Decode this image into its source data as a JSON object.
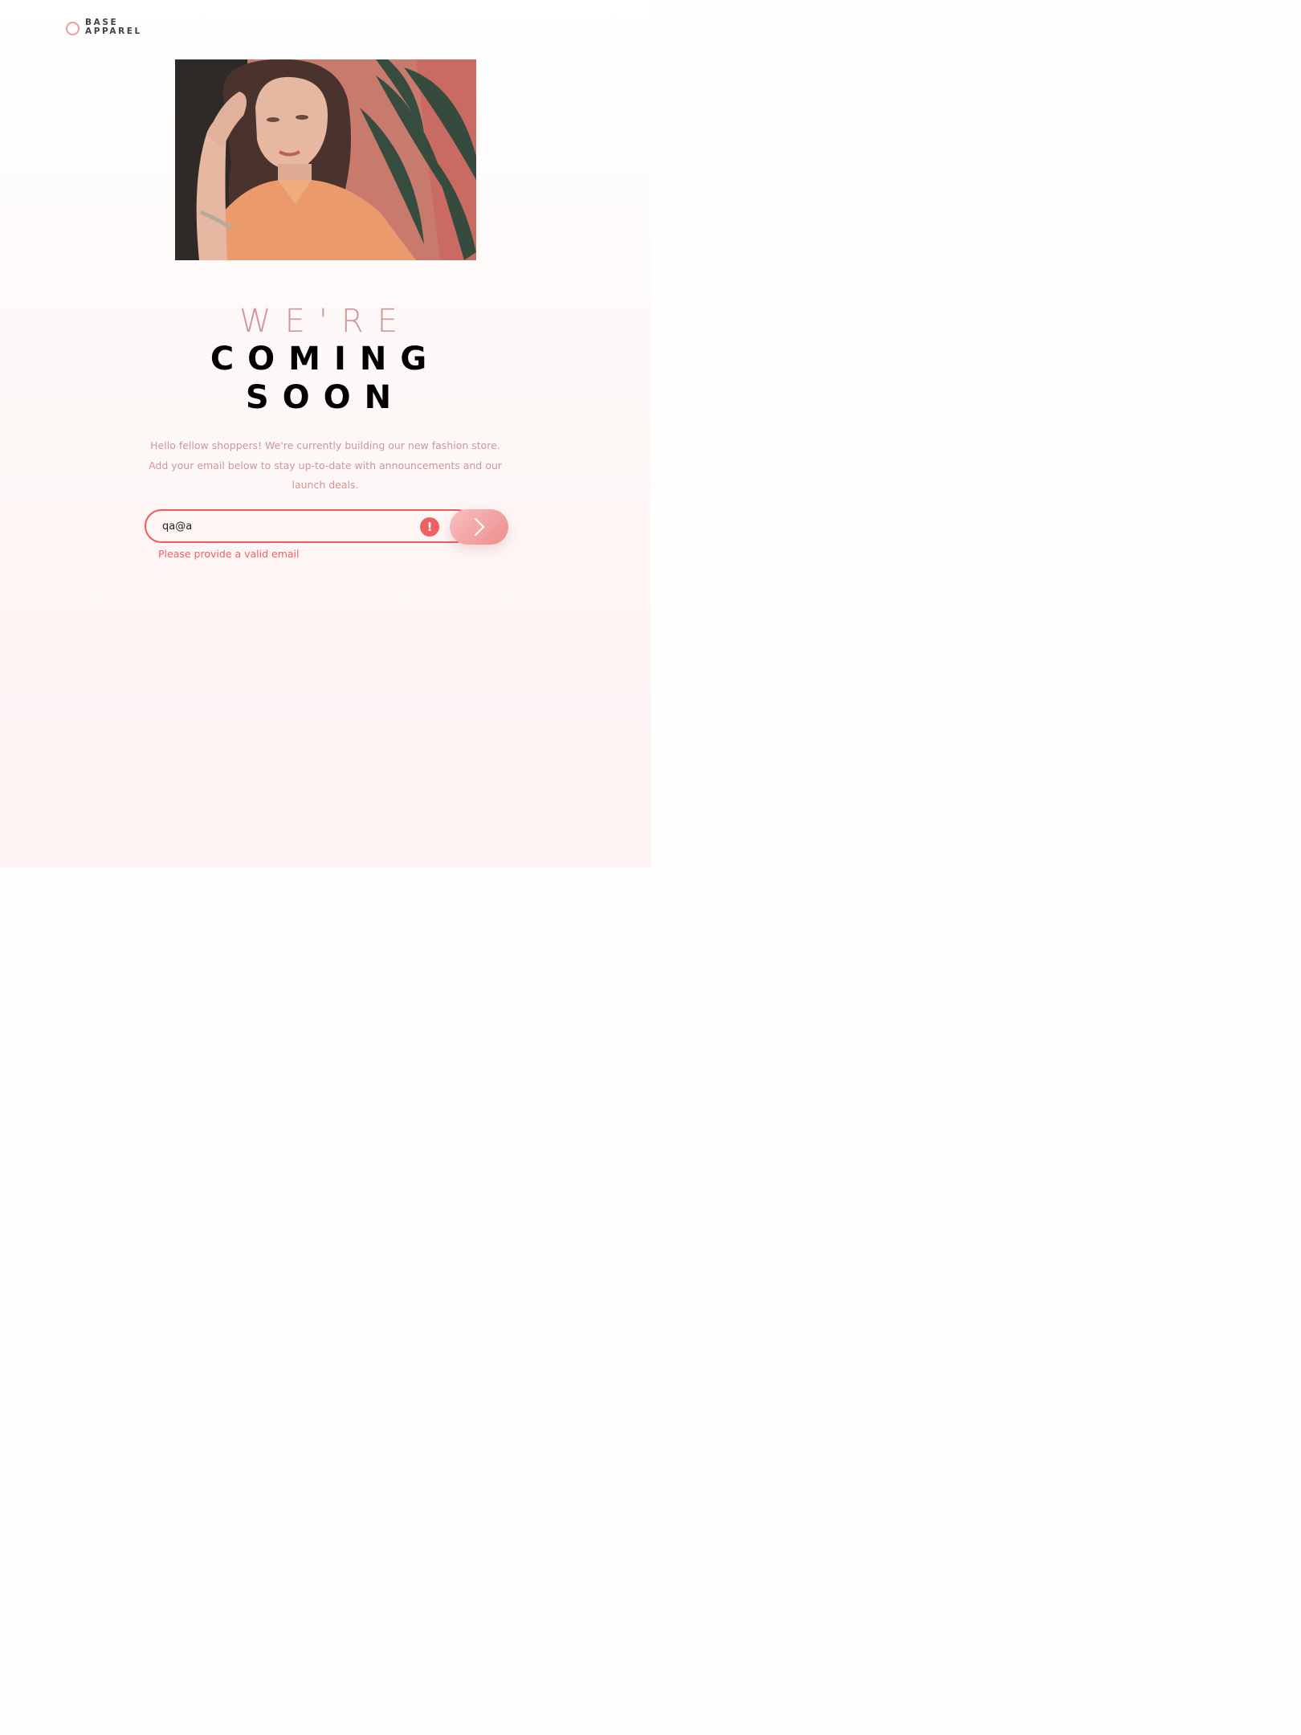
{
  "brand": {
    "line1": "BASE",
    "line2": "APPAREL"
  },
  "headline": {
    "line1": "WE'RE",
    "line2": "COMING",
    "line3": "SOON"
  },
  "description": "Hello fellow shoppers! We're currently building our new fashion store. Add your email below to stay up-to-date with announcements and our launch deals.",
  "form": {
    "email_value": "qa@a",
    "error_icon": "!",
    "error_message": "Please provide a valid email"
  },
  "colors": {
    "accent": "#ce9797",
    "error": "#f06060",
    "button_start": "#f8bfbf",
    "button_end": "#ee8c8c"
  },
  "icons": {
    "logo": "circle-logo-icon",
    "submit": "chevron-right-icon",
    "error": "error-alert-icon"
  }
}
